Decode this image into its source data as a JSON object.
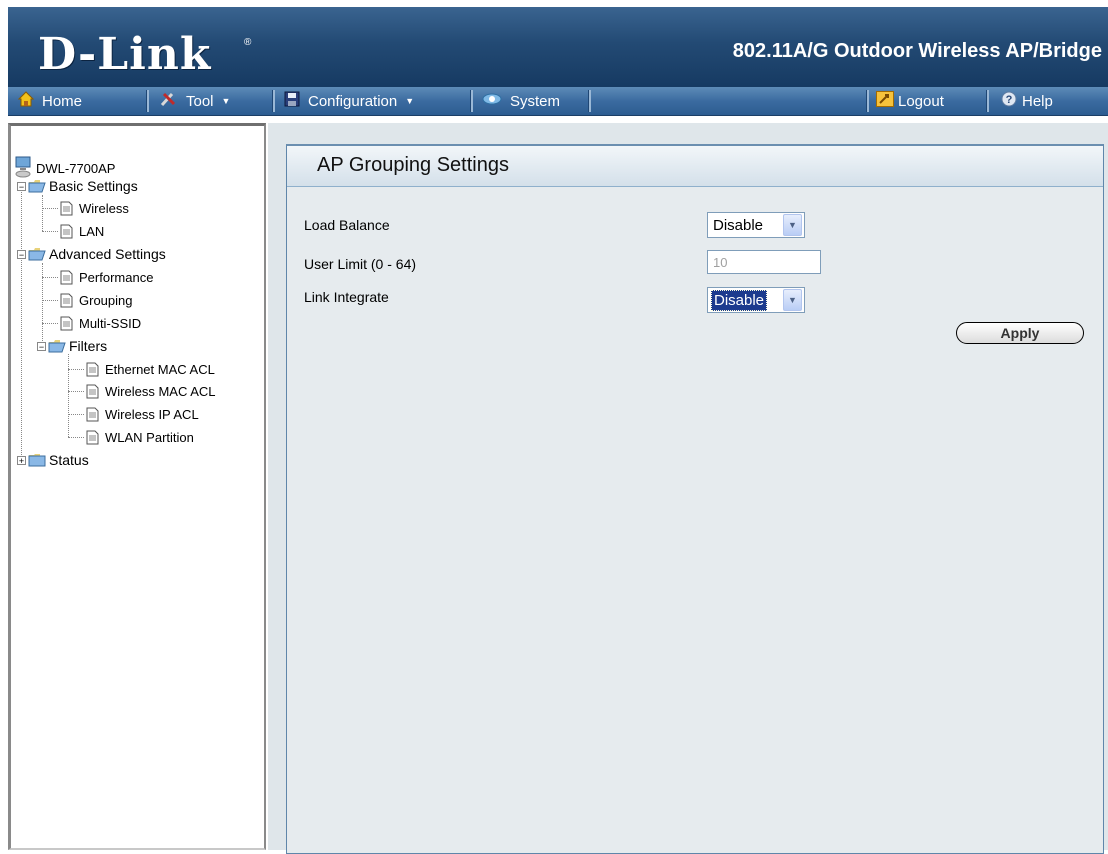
{
  "header": {
    "logo": "D-Link",
    "logo_mark": "®",
    "product_title": "802.11A/G Outdoor Wireless AP/Bridge"
  },
  "toolbar": {
    "items": [
      {
        "label": "Home",
        "icon": "home-icon"
      },
      {
        "label": "Tool",
        "icon": "tool-icon"
      },
      {
        "label": "Configuration",
        "icon": "save-icon"
      },
      {
        "label": "System",
        "icon": "system-icon"
      },
      {
        "label": "Logout",
        "icon": "logout-icon"
      },
      {
        "label": "Help",
        "icon": "help-icon"
      }
    ]
  },
  "tree": {
    "root": "DWL-7700AP",
    "basic": {
      "label": "Basic Settings",
      "children": [
        "Wireless",
        "LAN"
      ]
    },
    "advanced": {
      "label": "Advanced Settings",
      "children": [
        "Performance",
        "Grouping",
        "Multi-SSID"
      ]
    },
    "filters": {
      "label": "Filters",
      "children": [
        "Ethernet MAC ACL",
        "Wireless MAC ACL",
        "Wireless IP ACL",
        "WLAN Partition"
      ]
    },
    "status": "Status"
  },
  "content": {
    "title": "AP Grouping Settings",
    "load_balance": {
      "label": "Load Balance",
      "value": "Disable"
    },
    "user_limit": {
      "label": "User Limit (0 - 64)",
      "value": "10"
    },
    "link_integrate": {
      "label": "Link Integrate",
      "value": "Disable"
    },
    "apply_label": "Apply"
  },
  "colors": {
    "header": "#234a74",
    "toolbar": "#3b6ba0",
    "panel_bg": "#e6ebee"
  }
}
